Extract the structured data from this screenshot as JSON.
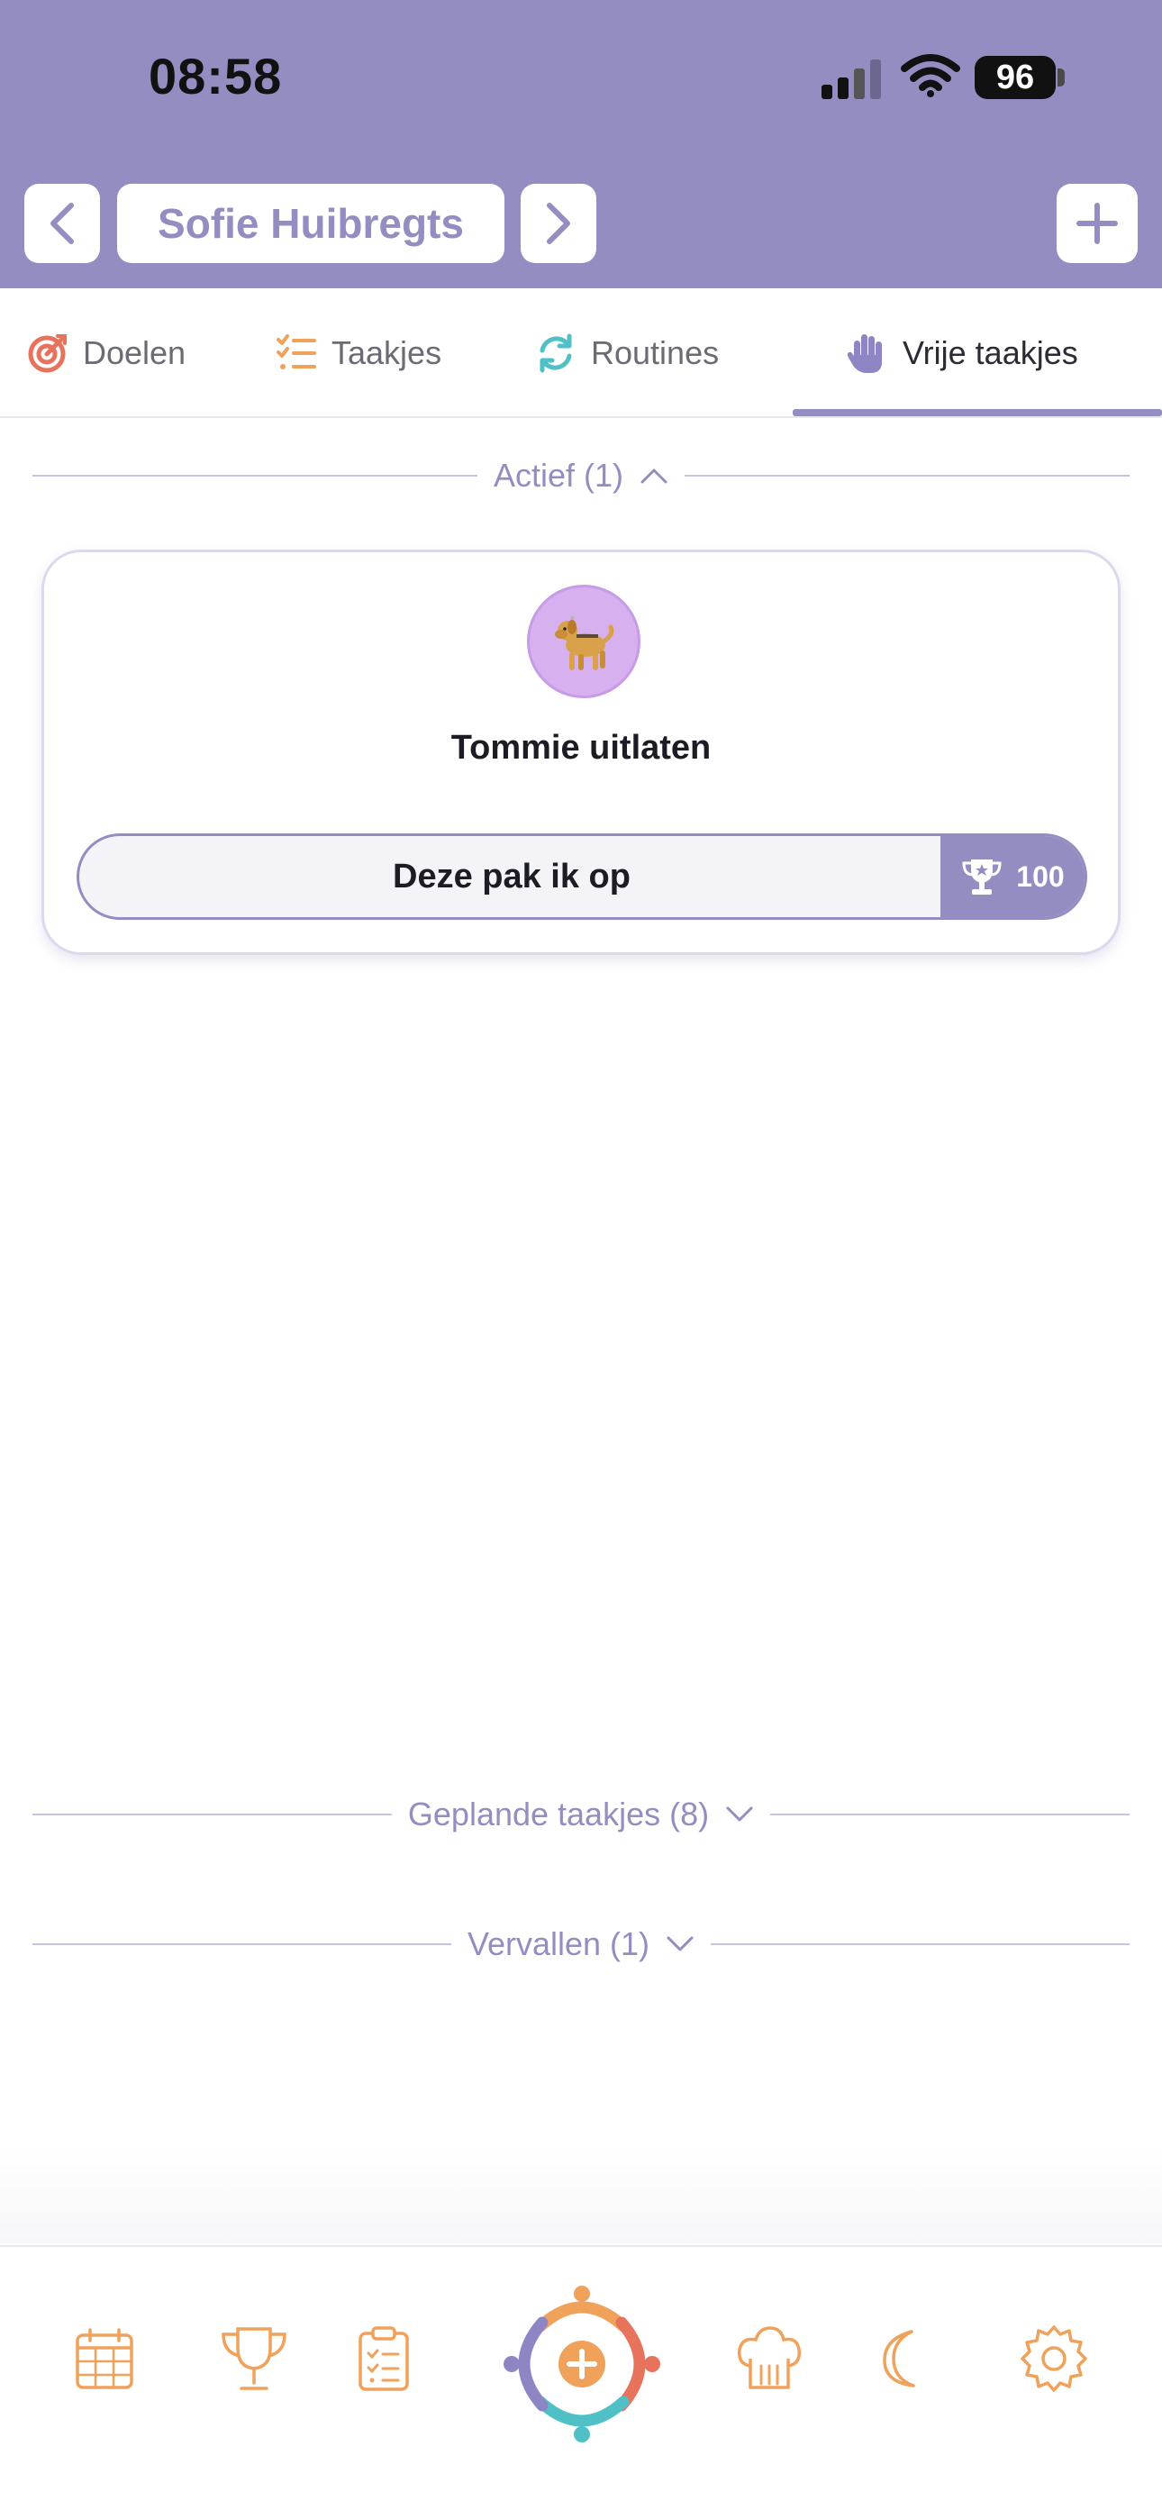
{
  "status_bar": {
    "time": "08:58",
    "battery": "96"
  },
  "header": {
    "profile_name": "Sofie Huibregts",
    "prev_icon": "chevron-left-icon",
    "next_icon": "chevron-right-icon",
    "add_icon": "plus-icon"
  },
  "tabs": [
    {
      "label": "Doelen",
      "icon": "target-icon"
    },
    {
      "label": "Taakjes",
      "icon": "checklist-icon"
    },
    {
      "label": "Routines",
      "icon": "refresh-icon"
    },
    {
      "label": "Vrije taakjes",
      "icon": "hand-icon",
      "active": true
    }
  ],
  "sections": {
    "active": {
      "label": "Actief (1)",
      "expanded": true
    },
    "planned": {
      "label": "Geplande taakjes (8)",
      "expanded": false
    },
    "expired": {
      "label": "Vervallen (1)",
      "expanded": false
    }
  },
  "task": {
    "title": "Tommie uitlaten",
    "icon": "guide-dog-icon",
    "action_label": "Deze pak ik op",
    "reward": "100",
    "reward_icon": "trophy-icon"
  },
  "bottom_nav": [
    {
      "icon": "calendar-icon"
    },
    {
      "icon": "trophy-icon"
    },
    {
      "icon": "clipboard-icon"
    },
    {
      "icon": "app-logo-add-icon"
    },
    {
      "icon": "chef-hat-icon"
    },
    {
      "icon": "moon-icon"
    },
    {
      "icon": "settings-gear-icon"
    }
  ],
  "colors": {
    "primary": "#938dc2",
    "accent_orange": "#f0a15a",
    "avatar_bg": "#d7b0f0"
  }
}
